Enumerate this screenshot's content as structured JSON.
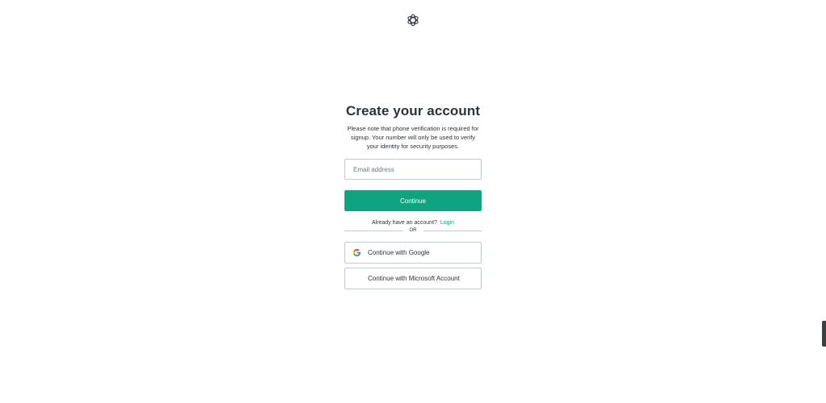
{
  "header": {
    "logo_icon": "openai-logo-icon"
  },
  "signup": {
    "title": "Create your account",
    "subtitle": "Please note that phone verification is required for signup. Your number will only be used to verify your identity for security purposes.",
    "email_placeholder": "Email address",
    "email_value": "",
    "continue_label": "Continue",
    "login_prompt": "Already have an account?",
    "login_link": "Login",
    "divider_text": "OR",
    "google_label": "Continue with Google",
    "microsoft_label": "Continue with Microsoft Account"
  },
  "colors": {
    "accent": "#10a37f",
    "text": "#2d333a",
    "border": "#c2c8d0",
    "microsoft": [
      "#f25022",
      "#7fba00",
      "#00a4ef",
      "#ffb900"
    ],
    "google": [
      "#4285f4",
      "#34a853",
      "#fbbc05",
      "#ea4335"
    ]
  }
}
